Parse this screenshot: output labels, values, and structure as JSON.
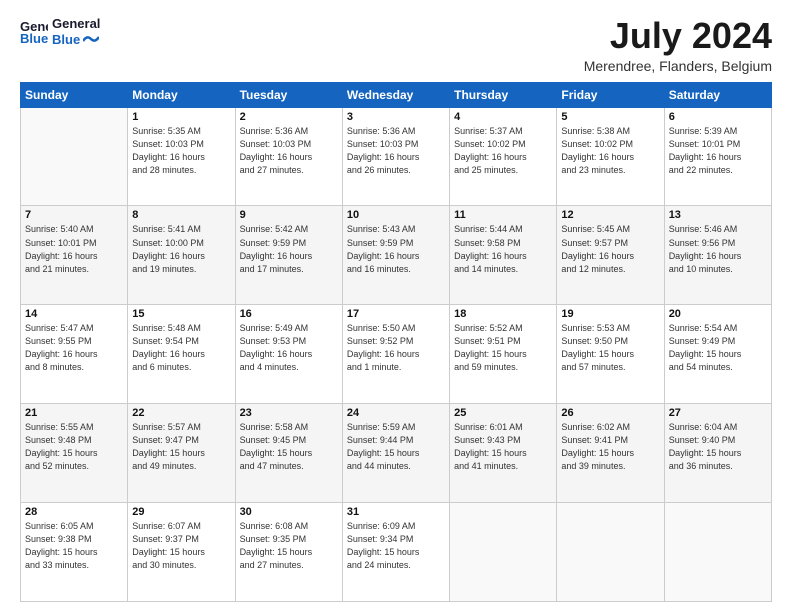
{
  "header": {
    "logo_line1": "General",
    "logo_line2": "Blue",
    "month": "July 2024",
    "location": "Merendree, Flanders, Belgium"
  },
  "weekdays": [
    "Sunday",
    "Monday",
    "Tuesday",
    "Wednesday",
    "Thursday",
    "Friday",
    "Saturday"
  ],
  "weeks": [
    [
      {
        "day": "",
        "info": ""
      },
      {
        "day": "1",
        "info": "Sunrise: 5:35 AM\nSunset: 10:03 PM\nDaylight: 16 hours\nand 28 minutes."
      },
      {
        "day": "2",
        "info": "Sunrise: 5:36 AM\nSunset: 10:03 PM\nDaylight: 16 hours\nand 27 minutes."
      },
      {
        "day": "3",
        "info": "Sunrise: 5:36 AM\nSunset: 10:03 PM\nDaylight: 16 hours\nand 26 minutes."
      },
      {
        "day": "4",
        "info": "Sunrise: 5:37 AM\nSunset: 10:02 PM\nDaylight: 16 hours\nand 25 minutes."
      },
      {
        "day": "5",
        "info": "Sunrise: 5:38 AM\nSunset: 10:02 PM\nDaylight: 16 hours\nand 23 minutes."
      },
      {
        "day": "6",
        "info": "Sunrise: 5:39 AM\nSunset: 10:01 PM\nDaylight: 16 hours\nand 22 minutes."
      }
    ],
    [
      {
        "day": "7",
        "info": "Sunrise: 5:40 AM\nSunset: 10:01 PM\nDaylight: 16 hours\nand 21 minutes."
      },
      {
        "day": "8",
        "info": "Sunrise: 5:41 AM\nSunset: 10:00 PM\nDaylight: 16 hours\nand 19 minutes."
      },
      {
        "day": "9",
        "info": "Sunrise: 5:42 AM\nSunset: 9:59 PM\nDaylight: 16 hours\nand 17 minutes."
      },
      {
        "day": "10",
        "info": "Sunrise: 5:43 AM\nSunset: 9:59 PM\nDaylight: 16 hours\nand 16 minutes."
      },
      {
        "day": "11",
        "info": "Sunrise: 5:44 AM\nSunset: 9:58 PM\nDaylight: 16 hours\nand 14 minutes."
      },
      {
        "day": "12",
        "info": "Sunrise: 5:45 AM\nSunset: 9:57 PM\nDaylight: 16 hours\nand 12 minutes."
      },
      {
        "day": "13",
        "info": "Sunrise: 5:46 AM\nSunset: 9:56 PM\nDaylight: 16 hours\nand 10 minutes."
      }
    ],
    [
      {
        "day": "14",
        "info": "Sunrise: 5:47 AM\nSunset: 9:55 PM\nDaylight: 16 hours\nand 8 minutes."
      },
      {
        "day": "15",
        "info": "Sunrise: 5:48 AM\nSunset: 9:54 PM\nDaylight: 16 hours\nand 6 minutes."
      },
      {
        "day": "16",
        "info": "Sunrise: 5:49 AM\nSunset: 9:53 PM\nDaylight: 16 hours\nand 4 minutes."
      },
      {
        "day": "17",
        "info": "Sunrise: 5:50 AM\nSunset: 9:52 PM\nDaylight: 16 hours\nand 1 minute."
      },
      {
        "day": "18",
        "info": "Sunrise: 5:52 AM\nSunset: 9:51 PM\nDaylight: 15 hours\nand 59 minutes."
      },
      {
        "day": "19",
        "info": "Sunrise: 5:53 AM\nSunset: 9:50 PM\nDaylight: 15 hours\nand 57 minutes."
      },
      {
        "day": "20",
        "info": "Sunrise: 5:54 AM\nSunset: 9:49 PM\nDaylight: 15 hours\nand 54 minutes."
      }
    ],
    [
      {
        "day": "21",
        "info": "Sunrise: 5:55 AM\nSunset: 9:48 PM\nDaylight: 15 hours\nand 52 minutes."
      },
      {
        "day": "22",
        "info": "Sunrise: 5:57 AM\nSunset: 9:47 PM\nDaylight: 15 hours\nand 49 minutes."
      },
      {
        "day": "23",
        "info": "Sunrise: 5:58 AM\nSunset: 9:45 PM\nDaylight: 15 hours\nand 47 minutes."
      },
      {
        "day": "24",
        "info": "Sunrise: 5:59 AM\nSunset: 9:44 PM\nDaylight: 15 hours\nand 44 minutes."
      },
      {
        "day": "25",
        "info": "Sunrise: 6:01 AM\nSunset: 9:43 PM\nDaylight: 15 hours\nand 41 minutes."
      },
      {
        "day": "26",
        "info": "Sunrise: 6:02 AM\nSunset: 9:41 PM\nDaylight: 15 hours\nand 39 minutes."
      },
      {
        "day": "27",
        "info": "Sunrise: 6:04 AM\nSunset: 9:40 PM\nDaylight: 15 hours\nand 36 minutes."
      }
    ],
    [
      {
        "day": "28",
        "info": "Sunrise: 6:05 AM\nSunset: 9:38 PM\nDaylight: 15 hours\nand 33 minutes."
      },
      {
        "day": "29",
        "info": "Sunrise: 6:07 AM\nSunset: 9:37 PM\nDaylight: 15 hours\nand 30 minutes."
      },
      {
        "day": "30",
        "info": "Sunrise: 6:08 AM\nSunset: 9:35 PM\nDaylight: 15 hours\nand 27 minutes."
      },
      {
        "day": "31",
        "info": "Sunrise: 6:09 AM\nSunset: 9:34 PM\nDaylight: 15 hours\nand 24 minutes."
      },
      {
        "day": "",
        "info": ""
      },
      {
        "day": "",
        "info": ""
      },
      {
        "day": "",
        "info": ""
      }
    ]
  ]
}
